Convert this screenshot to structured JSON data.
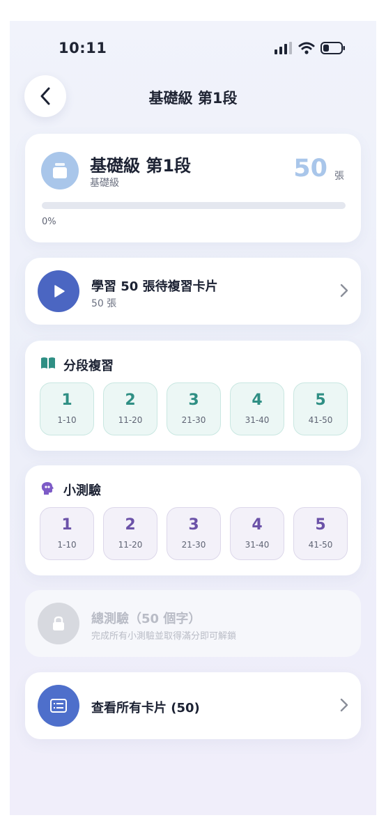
{
  "status_bar": {
    "time": "10:11"
  },
  "header": {
    "title": "基礎級 第1段"
  },
  "summary": {
    "title": "基礎級 第1段",
    "subtitle": "基礎級",
    "count": "50",
    "count_unit": "張",
    "progress": 0,
    "progress_label": "0%"
  },
  "study": {
    "label": "學習 50 張待複習卡片",
    "sub": "50 張"
  },
  "review": {
    "title": "分段複習",
    "tiles": [
      {
        "num": "1",
        "range": "1-10"
      },
      {
        "num": "2",
        "range": "11-20"
      },
      {
        "num": "3",
        "range": "21-30"
      },
      {
        "num": "4",
        "range": "31-40"
      },
      {
        "num": "5",
        "range": "41-50"
      }
    ]
  },
  "quiz": {
    "title": "小測驗",
    "tiles": [
      {
        "num": "1",
        "range": "1-10"
      },
      {
        "num": "2",
        "range": "11-20"
      },
      {
        "num": "3",
        "range": "21-30"
      },
      {
        "num": "4",
        "range": "31-40"
      },
      {
        "num": "5",
        "range": "41-50"
      }
    ]
  },
  "exam": {
    "label": "總測驗（50 個字）",
    "sub": "完成所有小測驗並取得滿分即可解鎖",
    "locked": true
  },
  "view_all": {
    "label": "查看所有卡片 (50)"
  },
  "colors": {
    "accent_blue": "#4b66c2",
    "badge_blue": "#a9c6ea",
    "review_teal": "#2f8f84",
    "quiz_purple": "#6b52a8"
  },
  "icons": {
    "back": "chevron-left-icon",
    "deck": "deck-icon",
    "play": "play-icon",
    "review": "book-icon",
    "quiz": "brain-icon",
    "exam": "lock-icon",
    "view_all": "list-icon",
    "chevron": "chevron-right-icon"
  }
}
